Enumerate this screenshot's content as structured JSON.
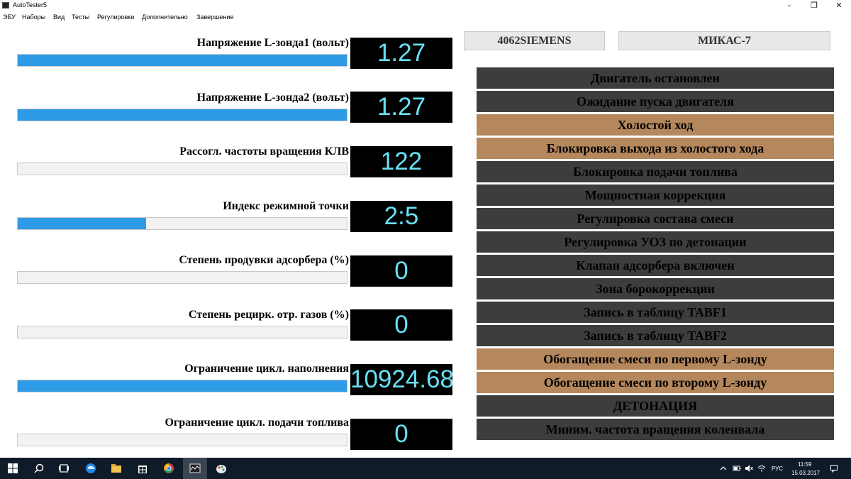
{
  "window": {
    "title": "AutoTester5"
  },
  "menu": [
    "ЭБУ",
    "Наборы",
    "Вид",
    "Тесты",
    "Регулировки",
    "Дополнительно",
    "Завершение"
  ],
  "parameters": [
    {
      "label": "Напряжение L-зонда1 (вольт)",
      "value": "1.27",
      "bar_fraction": 1.0
    },
    {
      "label": "Напряжение L-зонда2 (вольт)",
      "value": "1.27",
      "bar_fraction": 1.0
    },
    {
      "label": "Рассогл. частоты вращения КЛВ",
      "value": "122",
      "bar_fraction": 0.0
    },
    {
      "label": "Индекс режимной точки",
      "value": "2:5",
      "bar_fraction": 0.39
    },
    {
      "label": "Степень продувки адсорбера (%)",
      "value": "0",
      "bar_fraction": 0.0
    },
    {
      "label": "Степень рецирк. отр. газов (%)",
      "value": "0",
      "bar_fraction": 0.0
    },
    {
      "label": "Ограничение цикл. наполнения",
      "value": "10924.68",
      "bar_fraction": 1.0
    },
    {
      "label": "Ограничение цикл. подачи топлива",
      "value": "0",
      "bar_fraction": 0.0
    }
  ],
  "ecu": {
    "left": "4062SIEMENS",
    "right": "МИКАС-7"
  },
  "statuses": [
    {
      "label": "Двигатель остановлен",
      "active": false
    },
    {
      "label": "Ожидание пуска двигателя",
      "active": false
    },
    {
      "label": "Холостой ход",
      "active": true
    },
    {
      "label": "Блокировка выхода из холостого хода",
      "active": true
    },
    {
      "label": "Блокировка подачи топлива",
      "active": false
    },
    {
      "label": "Мощностная коррекция",
      "active": false
    },
    {
      "label": "Регулировка состава смеси",
      "active": false
    },
    {
      "label": "Регулировка УОЗ по детонации",
      "active": false
    },
    {
      "label": "Клапан адсорбера включен",
      "active": false
    },
    {
      "label": "Зона борокоррекции",
      "active": false
    },
    {
      "label": "Запись в таблицу TABF1",
      "active": false
    },
    {
      "label": "Запись в таблицу TABF2",
      "active": false
    },
    {
      "label": "Обогащение смеси по первому L-зонду",
      "active": true
    },
    {
      "label": "Обогащение смеси по второму  L-зонду",
      "active": true
    },
    {
      "label": "ДЕТОНАЦИЯ",
      "active": false
    },
    {
      "label": "Миним. частота вращения коленвала",
      "active": false
    }
  ],
  "colors": {
    "active": "#b5875d",
    "inactive": "#3d3d3d",
    "bar": "#2d9be6",
    "value_text": "#68e0f3"
  },
  "taskbar": {
    "icons": [
      "windows-start-icon",
      "search-icon",
      "task-view-icon",
      "edge-browser-icon",
      "file-explorer-icon",
      "store-icon",
      "chrome-icon",
      "autotester-app-icon",
      "paint-app-icon"
    ],
    "language": "РУС",
    "time": "11:59",
    "date": "15.03.2017"
  }
}
